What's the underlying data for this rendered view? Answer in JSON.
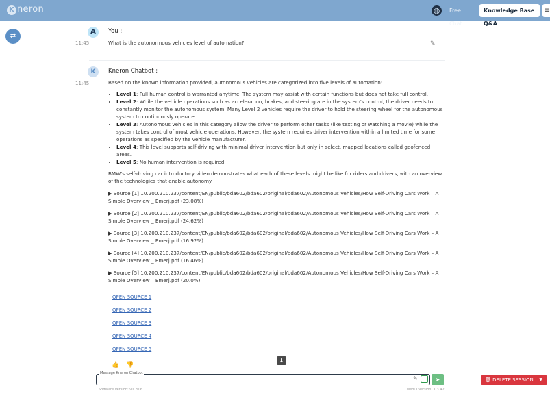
{
  "header": {
    "logo_text": "neron",
    "logo_letter": "K",
    "tabs": [
      {
        "label": "Free Chat"
      },
      {
        "label": "Knowledge Base Q&A"
      }
    ]
  },
  "conversation": {
    "user": {
      "avatar": "A",
      "name": "You :",
      "time": "11:45",
      "text": "What is the autonormous vehicles level of automation?"
    },
    "bot": {
      "avatar": "K",
      "name": "Kneron Chatbot :",
      "time": "11:45",
      "intro": "Based on the known information provided, autonomous vehicles are categorized into five levels of automation:",
      "levels": [
        {
          "title": "Level 1",
          "text": ": Full human control is warranted anytime. The system may assist with certain functions but does not take full control."
        },
        {
          "title": "Level 2",
          "text": ": While the vehicle operations such as acceleration, brakes, and steering are in the system's control, the driver needs to constantly monitor the autonomous system. Many Level 2 vehicles require the driver to hold the steering wheel for the autonomous system to continuously operate."
        },
        {
          "title": "Level 3",
          "text": ": Autonomous vehicles in this category allow the driver to perform other tasks (like texting or watching a movie) while the system takes control of most vehicle operations. However, the system requires driver intervention within a limited time for some operations as specified by the vehicle manufacturer."
        },
        {
          "title": "Level 4",
          "text": ": This level supports self-driving with minimal driver intervention but only in select, mapped locations called geofenced areas."
        },
        {
          "title": "Level 5",
          "text": ": No human intervention is required."
        }
      ],
      "summary": "BMW's self-driving car introductory video demonstrates what each of these levels might be like for riders and drivers, with an overview of the technologies that enable autonomy.",
      "sources": [
        "▶ Source [1] 10.200.210.237/content/EN/public/bda602/bda602/original/bda602/Autonomous Vehicles/How Self-Driving Cars Work – A Simple Overview _ Emerj.pdf (23.08%)",
        "▶ Source [2] 10.200.210.237/content/EN/public/bda602/bda602/original/bda602/Autonomous Vehicles/How Self-Driving Cars Work – A Simple Overview _ Emerj.pdf (24.62%)",
        "▶ Source [3] 10.200.210.237/content/EN/public/bda602/bda602/original/bda602/Autonomous Vehicles/How Self-Driving Cars Work – A Simple Overview _ Emerj.pdf (16.92%)",
        "▶ Source [4] 10.200.210.237/content/EN/public/bda602/bda602/original/bda602/Autonomous Vehicles/How Self-Driving Cars Work – A Simple Overview _ Emerj.pdf (16.46%)",
        "▶ Source [5] 10.200.210.237/content/EN/public/bda602/bda602/original/bda602/Autonomous Vehicles/How Self-Driving Cars Work – A Simple Overview _ Emerj.pdf (20.0%)"
      ],
      "links": [
        "OPEN SOURCE 1",
        "OPEN SOURCE 2",
        "OPEN SOURCE 3",
        "OPEN SOURCE 4",
        "OPEN SOURCE 5"
      ]
    }
  },
  "input": {
    "label": "Message Kneron Chatbot",
    "value": ""
  },
  "actions": {
    "delete_session": "DELETE SESSION"
  },
  "footer": {
    "software_version": "Software Version: v0.20.6",
    "webui_version": "webUI Version: 1.3.42"
  },
  "icons": {
    "globe": "globe-icon",
    "sidebar_toggle": "swap-icon",
    "edit": "pencil-icon",
    "thumb_up": "thumb-up-icon",
    "thumb_down": "thumb-down-icon",
    "download": "download-icon",
    "send": "send-icon",
    "trash": "trash-icon"
  },
  "colors": {
    "topbar": "#7fa7cf",
    "delete": "#d9363e",
    "send": "#6dbf83",
    "link": "#3566b5"
  }
}
